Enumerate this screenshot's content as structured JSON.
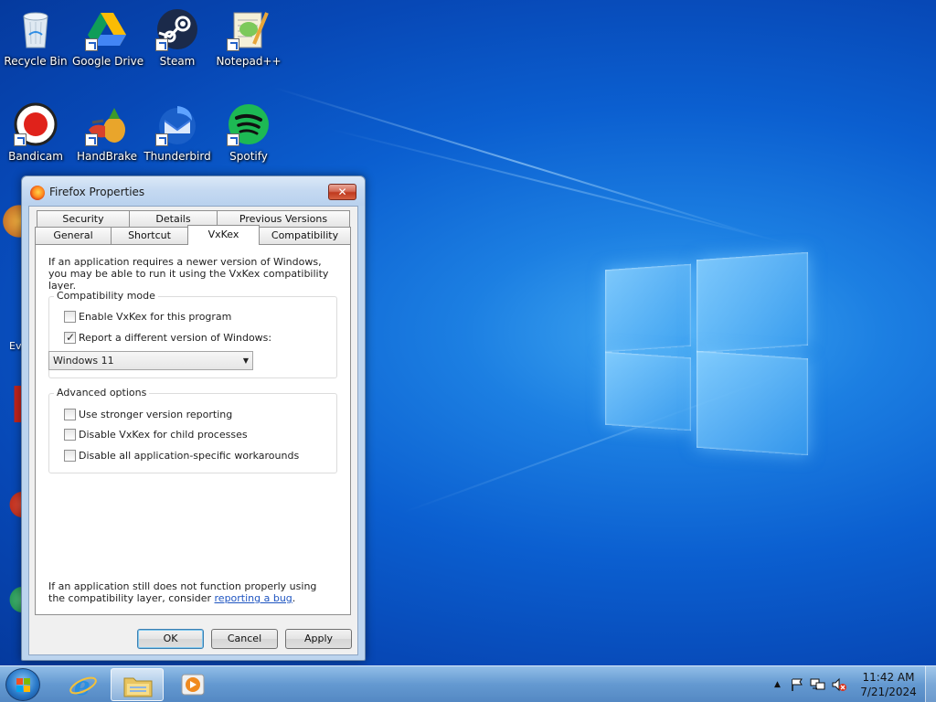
{
  "desktop": {
    "icons": [
      {
        "label": "Recycle Bin",
        "icon": "recycle-bin-icon"
      },
      {
        "label": "Google Drive",
        "icon": "google-drive-icon"
      },
      {
        "label": "Steam",
        "icon": "steam-icon"
      },
      {
        "label": "Notepad++",
        "icon": "notepad-plus-plus-icon"
      },
      {
        "label": "Bandicam",
        "icon": "bandicam-icon"
      },
      {
        "label": "HandBrake",
        "icon": "handbrake-icon"
      },
      {
        "label": "Thunderbird",
        "icon": "thunderbird-icon"
      },
      {
        "label": "Spotify",
        "icon": "spotify-icon"
      }
    ],
    "partial_label": "Ev"
  },
  "dialog": {
    "title": "Firefox Properties",
    "close_glyph": "✕",
    "tabs_row1": [
      "Security",
      "Details",
      "Previous Versions"
    ],
    "tabs_row2": [
      "General",
      "Shortcut",
      "VxKex",
      "Compatibility"
    ],
    "active_tab": "VxKex",
    "intro": "If an application requires a newer version of Windows, you may be able to run it using the VxKex compatibility layer.",
    "compat_group": {
      "title": "Compatibility mode",
      "enable_label": "Enable VxKex for this program",
      "enable_checked": false,
      "report_label": "Report a different version of Windows:",
      "report_checked": true,
      "selected_version": "Windows 11"
    },
    "advanced_group": {
      "title": "Advanced options",
      "options": [
        {
          "label": "Use stronger version reporting",
          "checked": false
        },
        {
          "label": "Disable VxKex for child processes",
          "checked": false
        },
        {
          "label": "Disable all application-specific workarounds",
          "checked": false
        }
      ]
    },
    "footer_text": "If an application still does not function properly using the compatibility layer, consider",
    "footer_link": "reporting a bug",
    "footer_end": ".",
    "buttons": {
      "ok": "OK",
      "cancel": "Cancel",
      "apply": "Apply"
    }
  },
  "taskbar": {
    "items": [
      "internet-explorer-icon",
      "file-explorer-icon",
      "media-player-icon"
    ],
    "tray": {
      "show_hidden": "▲",
      "time": "11:42 AM",
      "date": "7/21/2024"
    }
  },
  "colors": {
    "accent": "#0b5fd0",
    "link": "#1f55c1",
    "close": "#c0391e"
  }
}
